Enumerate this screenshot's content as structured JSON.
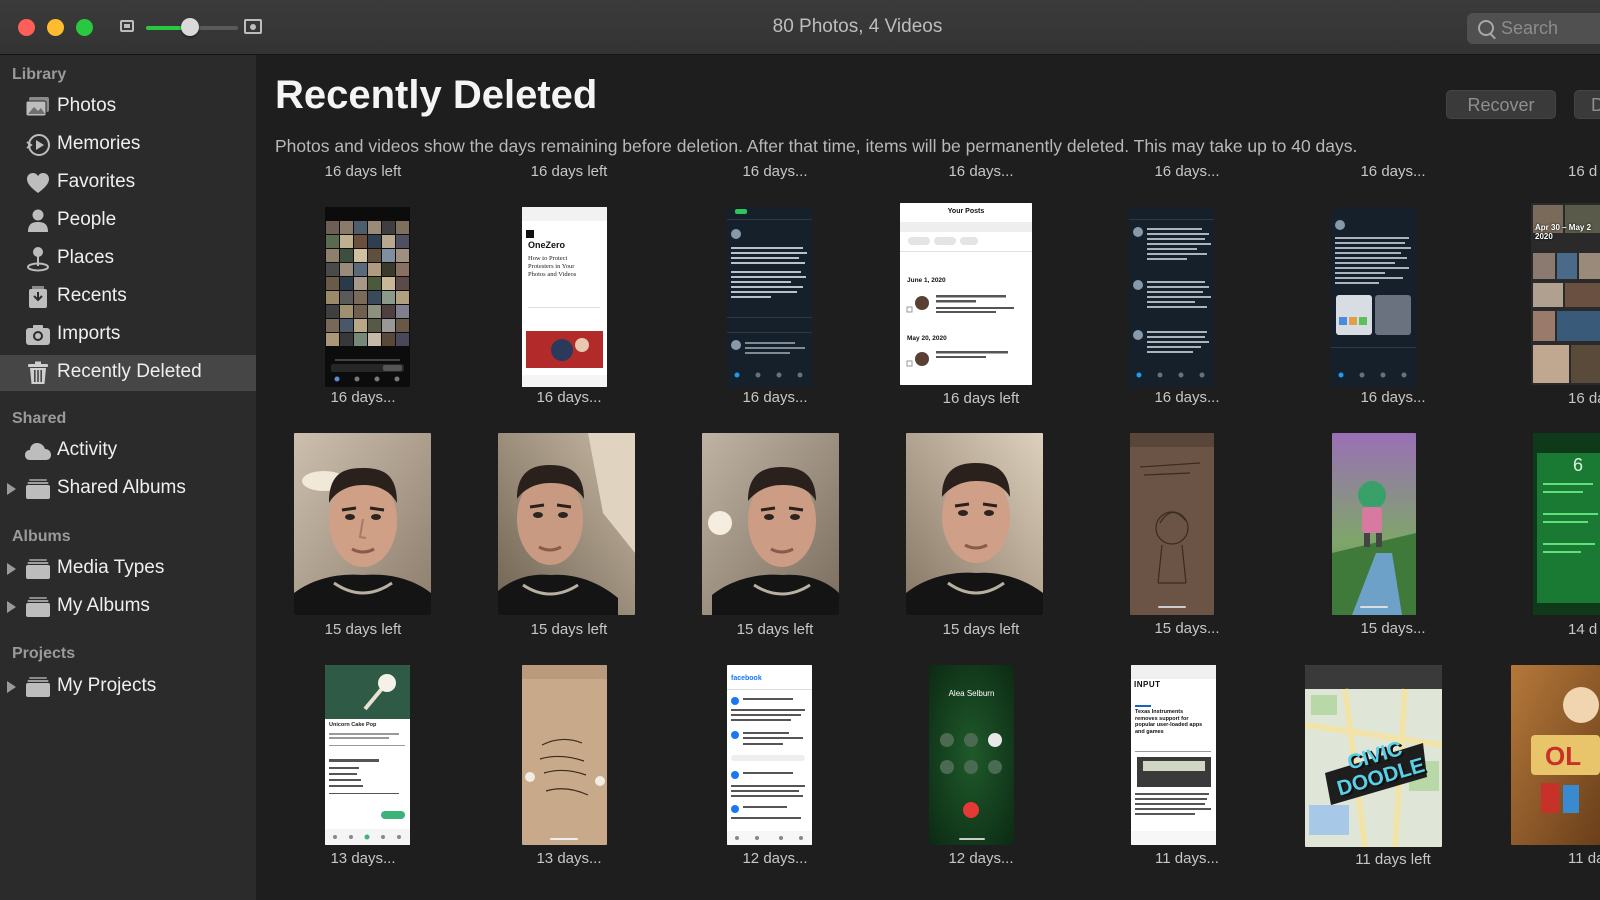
{
  "window": {
    "title": "80 Photos, 4 Videos",
    "zoom_level": 0.48
  },
  "search": {
    "placeholder": "Search"
  },
  "sidebar": {
    "sections": [
      "Library",
      "Shared",
      "Albums",
      "Projects"
    ],
    "items": [
      {
        "label": "Photos",
        "icon": "photos-icon"
      },
      {
        "label": "Memories",
        "icon": "memories-icon"
      },
      {
        "label": "Favorites",
        "icon": "heart-icon"
      },
      {
        "label": "People",
        "icon": "person-icon"
      },
      {
        "label": "Places",
        "icon": "map-pin-icon"
      },
      {
        "label": "Recents",
        "icon": "recents-icon"
      },
      {
        "label": "Imports",
        "icon": "camera-icon"
      },
      {
        "label": "Recently Deleted",
        "icon": "trash-icon",
        "selected": true
      },
      {
        "label": "Activity",
        "icon": "cloud-icon"
      },
      {
        "label": "Shared Albums",
        "icon": "folder-icon"
      },
      {
        "label": "Media Types",
        "icon": "folder-icon"
      },
      {
        "label": "My Albums",
        "icon": "folder-icon"
      },
      {
        "label": "My Projects",
        "icon": "folder-icon"
      }
    ]
  },
  "main": {
    "title": "Recently Deleted",
    "recover_label": "Recover",
    "delete_label": "D",
    "description": "Photos and videos show the days remaining before deletion. After that time, items will be permanently deleted. This may take up to 40 days.",
    "top_row_labels": [
      "16 days left",
      "16 days left",
      "16 days...",
      "16 days...",
      "16 days...",
      "16 days...",
      "16 d"
    ],
    "rows": [
      {
        "items": [
          {
            "label": "16 days...",
            "kind": "photo-grid"
          },
          {
            "label": "16 days...",
            "kind": "article",
            "text": "OneZero",
            "subtext": "How to Protect Protesters in Your Photos and Videos"
          },
          {
            "label": "16 days...",
            "kind": "dark-screen"
          },
          {
            "label": "16 days left",
            "kind": "light-screen",
            "header": "Your Posts",
            "dates": [
              "June 1, 2020",
              "May 20, 2020"
            ]
          },
          {
            "label": "16 days...",
            "kind": "dark-screen"
          },
          {
            "label": "16 days...",
            "kind": "dark-screen"
          },
          {
            "label": "16 da",
            "kind": "photo-collage",
            "text": "Apr 30 – May 2 2020"
          }
        ]
      },
      {
        "items": [
          {
            "label": "15 days left",
            "kind": "selfie"
          },
          {
            "label": "15 days left",
            "kind": "selfie"
          },
          {
            "label": "15 days left",
            "kind": "selfie"
          },
          {
            "label": "15 days left",
            "kind": "selfie"
          },
          {
            "label": "15 days...",
            "kind": "sketch"
          },
          {
            "label": "15 days...",
            "kind": "game"
          },
          {
            "label": "14 d",
            "kind": "green-screen"
          }
        ]
      },
      {
        "items": [
          {
            "label": "13 days...",
            "kind": "app-light",
            "text": "Unicorn Cake Pop"
          },
          {
            "label": "13 days...",
            "kind": "paper-note"
          },
          {
            "label": "12 days...",
            "kind": "facebook",
            "text": "facebook"
          },
          {
            "label": "12 days...",
            "kind": "call",
            "text": "Alea Selburn"
          },
          {
            "label": "11 days...",
            "kind": "article",
            "text": "INPUT",
            "subtext": "Texas Instruments removes support for popular user-loaded apps and games"
          },
          {
            "label": "11 days left",
            "kind": "map",
            "text": "CIVIC DOODLE"
          },
          {
            "label": "11 da",
            "kind": "toy"
          }
        ]
      }
    ]
  }
}
